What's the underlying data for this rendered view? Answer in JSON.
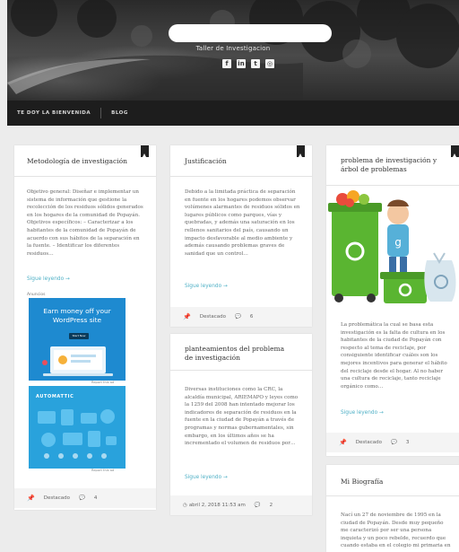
{
  "header": {
    "tagline": "Taller de Investigacion",
    "social": [
      {
        "icon": "facebook-icon",
        "glyph": "f"
      },
      {
        "icon": "linkedin-icon",
        "glyph": "in"
      },
      {
        "icon": "twitter-icon",
        "glyph": "t"
      },
      {
        "icon": "instagram-icon",
        "glyph": "◎"
      }
    ]
  },
  "nav": {
    "items": [
      "TE DOY LA BIENVENIDA",
      "BLOG"
    ]
  },
  "posts": {
    "metodologia": {
      "title": "Metodología de investigación",
      "excerpt": "Objetivo general: Diseñar e implementar un sistema de información que gestione la recolección de los residuos sólidos generados en los hogares de la comunidad de Popayán. Objetivos específicos: – Caracterizar a los habitantes de la comunidad de Popayán de acuerdo con sus hábitos de la separación en la fuente. – Identificar los diferentes residuos…",
      "readmore": "Sigue leyendo →",
      "ads_label": "Anuncios",
      "ad1_text": "Earn money off your WordPress site",
      "ad1_button": "Start Now",
      "ad2_text": "AUTOMATTIC",
      "ad_report": "Report this ad",
      "featured": "Destacado",
      "comments": "4"
    },
    "justificacion": {
      "title": "Justificación",
      "excerpt": "Debido a la limitada práctica de separación en fuente en los hogares podemos observar volúmenes alarmantes de residuos sólidos en lugares públicos como parques, vías y quebradas, y además una saturación en los rellenos sanitarios del país, causando un impacto desfavorable al medio ambiente y además causando problemas graves de sanidad que un control…",
      "readmore": "Sigue leyendo →",
      "featured": "Destacado",
      "comments": "6"
    },
    "planteamiento": {
      "title": "planteamientos del problema de investigación",
      "excerpt": "Diversas instituciones como la CRC, la alcaldía municipal, ARIEMAPO y leyes como la 1259 del 2008 han intentado mejorar los indicadores de separación de residuos en la fuente en la ciudad de Popayán a través de programas y normas gubernamentales, sin embargo, en los últimos años se ha incrementado el volumen de residuos por…",
      "readmore": "Sigue leyendo →",
      "date": "abril 2, 2018 11:53 am",
      "comments": "2"
    },
    "problema": {
      "title": "problema de investigación y árbol de problemas",
      "excerpt": "La problemática la cual se basa esta investigación es la falta de cultura en los habitantes de la ciudad de Popayán con respecto al tema de reciclaje, por consiguiente identificar cuáles son los mejores incentivos para generar el hábito del reciclaje desde el hogar. Al no haber una cultura de reciclaje, tanto reciclaje orgánico como…",
      "readmore": "Sigue leyendo →",
      "featured": "Destacado",
      "comments": "3"
    },
    "biografia": {
      "title": "Mi Biografía",
      "excerpt": "Nací un 27 de noviembre de 1995 en la ciudad de Popayán. Desde muy pequeño me caracterizó por ser una persona inquieta y un poco rebelde, recuerdo que cuando estaba en el colegio mi primaria en"
    }
  },
  "colors": {
    "accent": "#4fb0c6",
    "nav_bg": "#1d1d1d",
    "page_bg": "#ececec",
    "bin_green": "#5ab531"
  }
}
